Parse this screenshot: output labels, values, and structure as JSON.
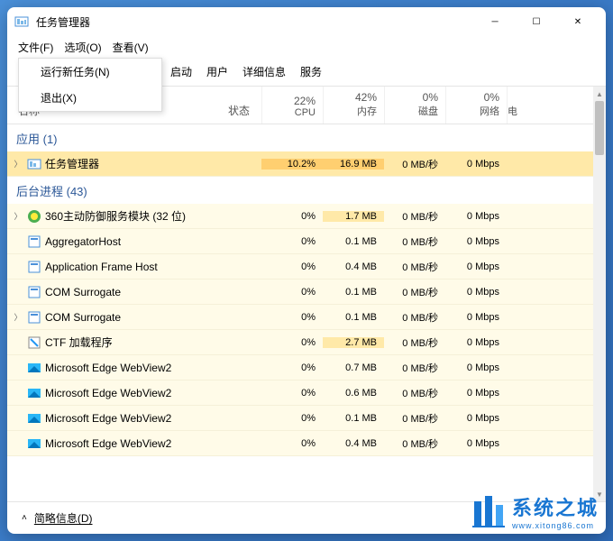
{
  "window": {
    "title": "任务管理器"
  },
  "menubar": {
    "file": "文件(F)",
    "options": "选项(O)",
    "view": "查看(V)"
  },
  "dropdown": {
    "run_new_task": "运行新任务(N)",
    "exit": "退出(X)"
  },
  "tabs": {
    "startup": "启动",
    "users": "用户",
    "details": "详细信息",
    "services": "服务"
  },
  "columns": {
    "name": "名称",
    "status": "状态",
    "cpu_pct": "22%",
    "cpu_lbl": "CPU",
    "mem_pct": "42%",
    "mem_lbl": "内存",
    "disk_pct": "0%",
    "disk_lbl": "磁盘",
    "net_pct": "0%",
    "net_lbl": "网络",
    "power": "电"
  },
  "groups": {
    "apps": "应用 (1)",
    "bg": "后台进程 (43)"
  },
  "rows": [
    {
      "expand": true,
      "icon": "taskmgr",
      "name": "任务管理器",
      "cpu": "10.2%",
      "mem": "16.9 MB",
      "disk": "0 MB/秒",
      "net": "0 Mbps",
      "hl": "hot"
    },
    {
      "expand": true,
      "icon": "360",
      "name": "360主动防御服务模块 (32 位)",
      "cpu": "0%",
      "mem": "1.7 MB",
      "disk": "0 MB/秒",
      "net": "0 Mbps"
    },
    {
      "expand": false,
      "icon": "app",
      "name": "AggregatorHost",
      "cpu": "0%",
      "mem": "0.1 MB",
      "disk": "0 MB/秒",
      "net": "0 Mbps"
    },
    {
      "expand": false,
      "icon": "app",
      "name": "Application Frame Host",
      "cpu": "0%",
      "mem": "0.4 MB",
      "disk": "0 MB/秒",
      "net": "0 Mbps"
    },
    {
      "expand": false,
      "icon": "app",
      "name": "COM Surrogate",
      "cpu": "0%",
      "mem": "0.1 MB",
      "disk": "0 MB/秒",
      "net": "0 Mbps"
    },
    {
      "expand": true,
      "icon": "app",
      "name": "COM Surrogate",
      "cpu": "0%",
      "mem": "0.1 MB",
      "disk": "0 MB/秒",
      "net": "0 Mbps"
    },
    {
      "expand": false,
      "icon": "ctf",
      "name": "CTF 加载程序",
      "cpu": "0%",
      "mem": "2.7 MB",
      "disk": "0 MB/秒",
      "net": "0 Mbps"
    },
    {
      "expand": false,
      "icon": "edge",
      "name": "Microsoft Edge WebView2",
      "cpu": "0%",
      "mem": "0.7 MB",
      "disk": "0 MB/秒",
      "net": "0 Mbps"
    },
    {
      "expand": false,
      "icon": "edge",
      "name": "Microsoft Edge WebView2",
      "cpu": "0%",
      "mem": "0.6 MB",
      "disk": "0 MB/秒",
      "net": "0 Mbps"
    },
    {
      "expand": false,
      "icon": "edge",
      "name": "Microsoft Edge WebView2",
      "cpu": "0%",
      "mem": "0.1 MB",
      "disk": "0 MB/秒",
      "net": "0 Mbps"
    },
    {
      "expand": false,
      "icon": "edge",
      "name": "Microsoft Edge WebView2",
      "cpu": "0%",
      "mem": "0.4 MB",
      "disk": "0 MB/秒",
      "net": "0 Mbps"
    }
  ],
  "footer": {
    "brief": "简略信息(D)"
  },
  "watermark": {
    "cn": "系统之城",
    "en": "www.xitong86.com"
  }
}
